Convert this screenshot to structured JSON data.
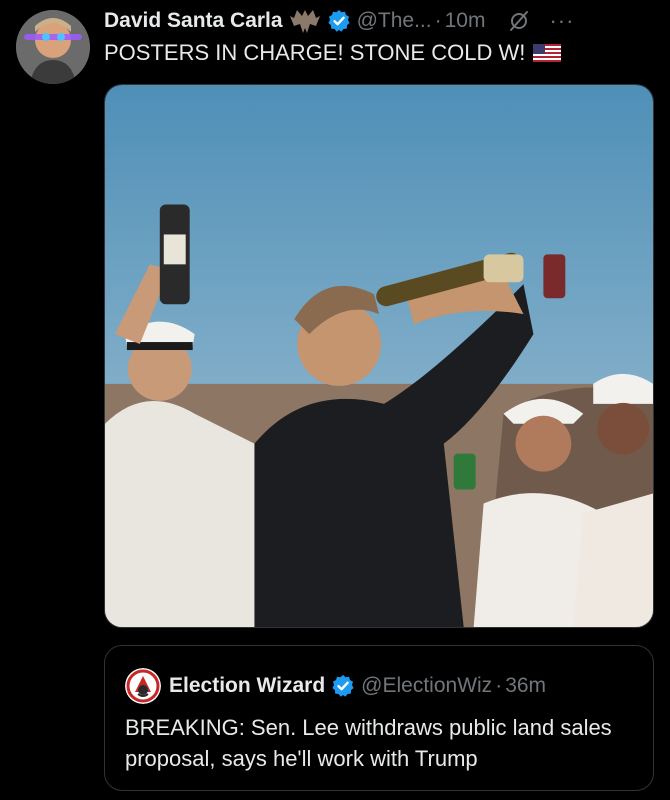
{
  "post": {
    "author_name": "David Santa Carla",
    "author_handle": "@The...",
    "time": "10m",
    "separator": "·",
    "text": "POSTERS IN CHARGE! STONE COLD W!",
    "more": "···"
  },
  "quoted": {
    "author_name": "Election Wizard",
    "author_handle": "@ElectionWiz",
    "time": "36m",
    "separator": "·",
    "text": "BREAKING: Sen. Lee withdraws public land sales proposal, says he'll work with Trump"
  },
  "colors": {
    "background": "#000000",
    "text": "#e7e9ea",
    "muted": "#71767b",
    "verified": "#1d9bf0",
    "border": "#2f3336"
  },
  "icons": {
    "badge": "bat-icon",
    "verified": "verified-badge-icon",
    "grok": "grok-icon",
    "flag": "us-flag-icon"
  }
}
